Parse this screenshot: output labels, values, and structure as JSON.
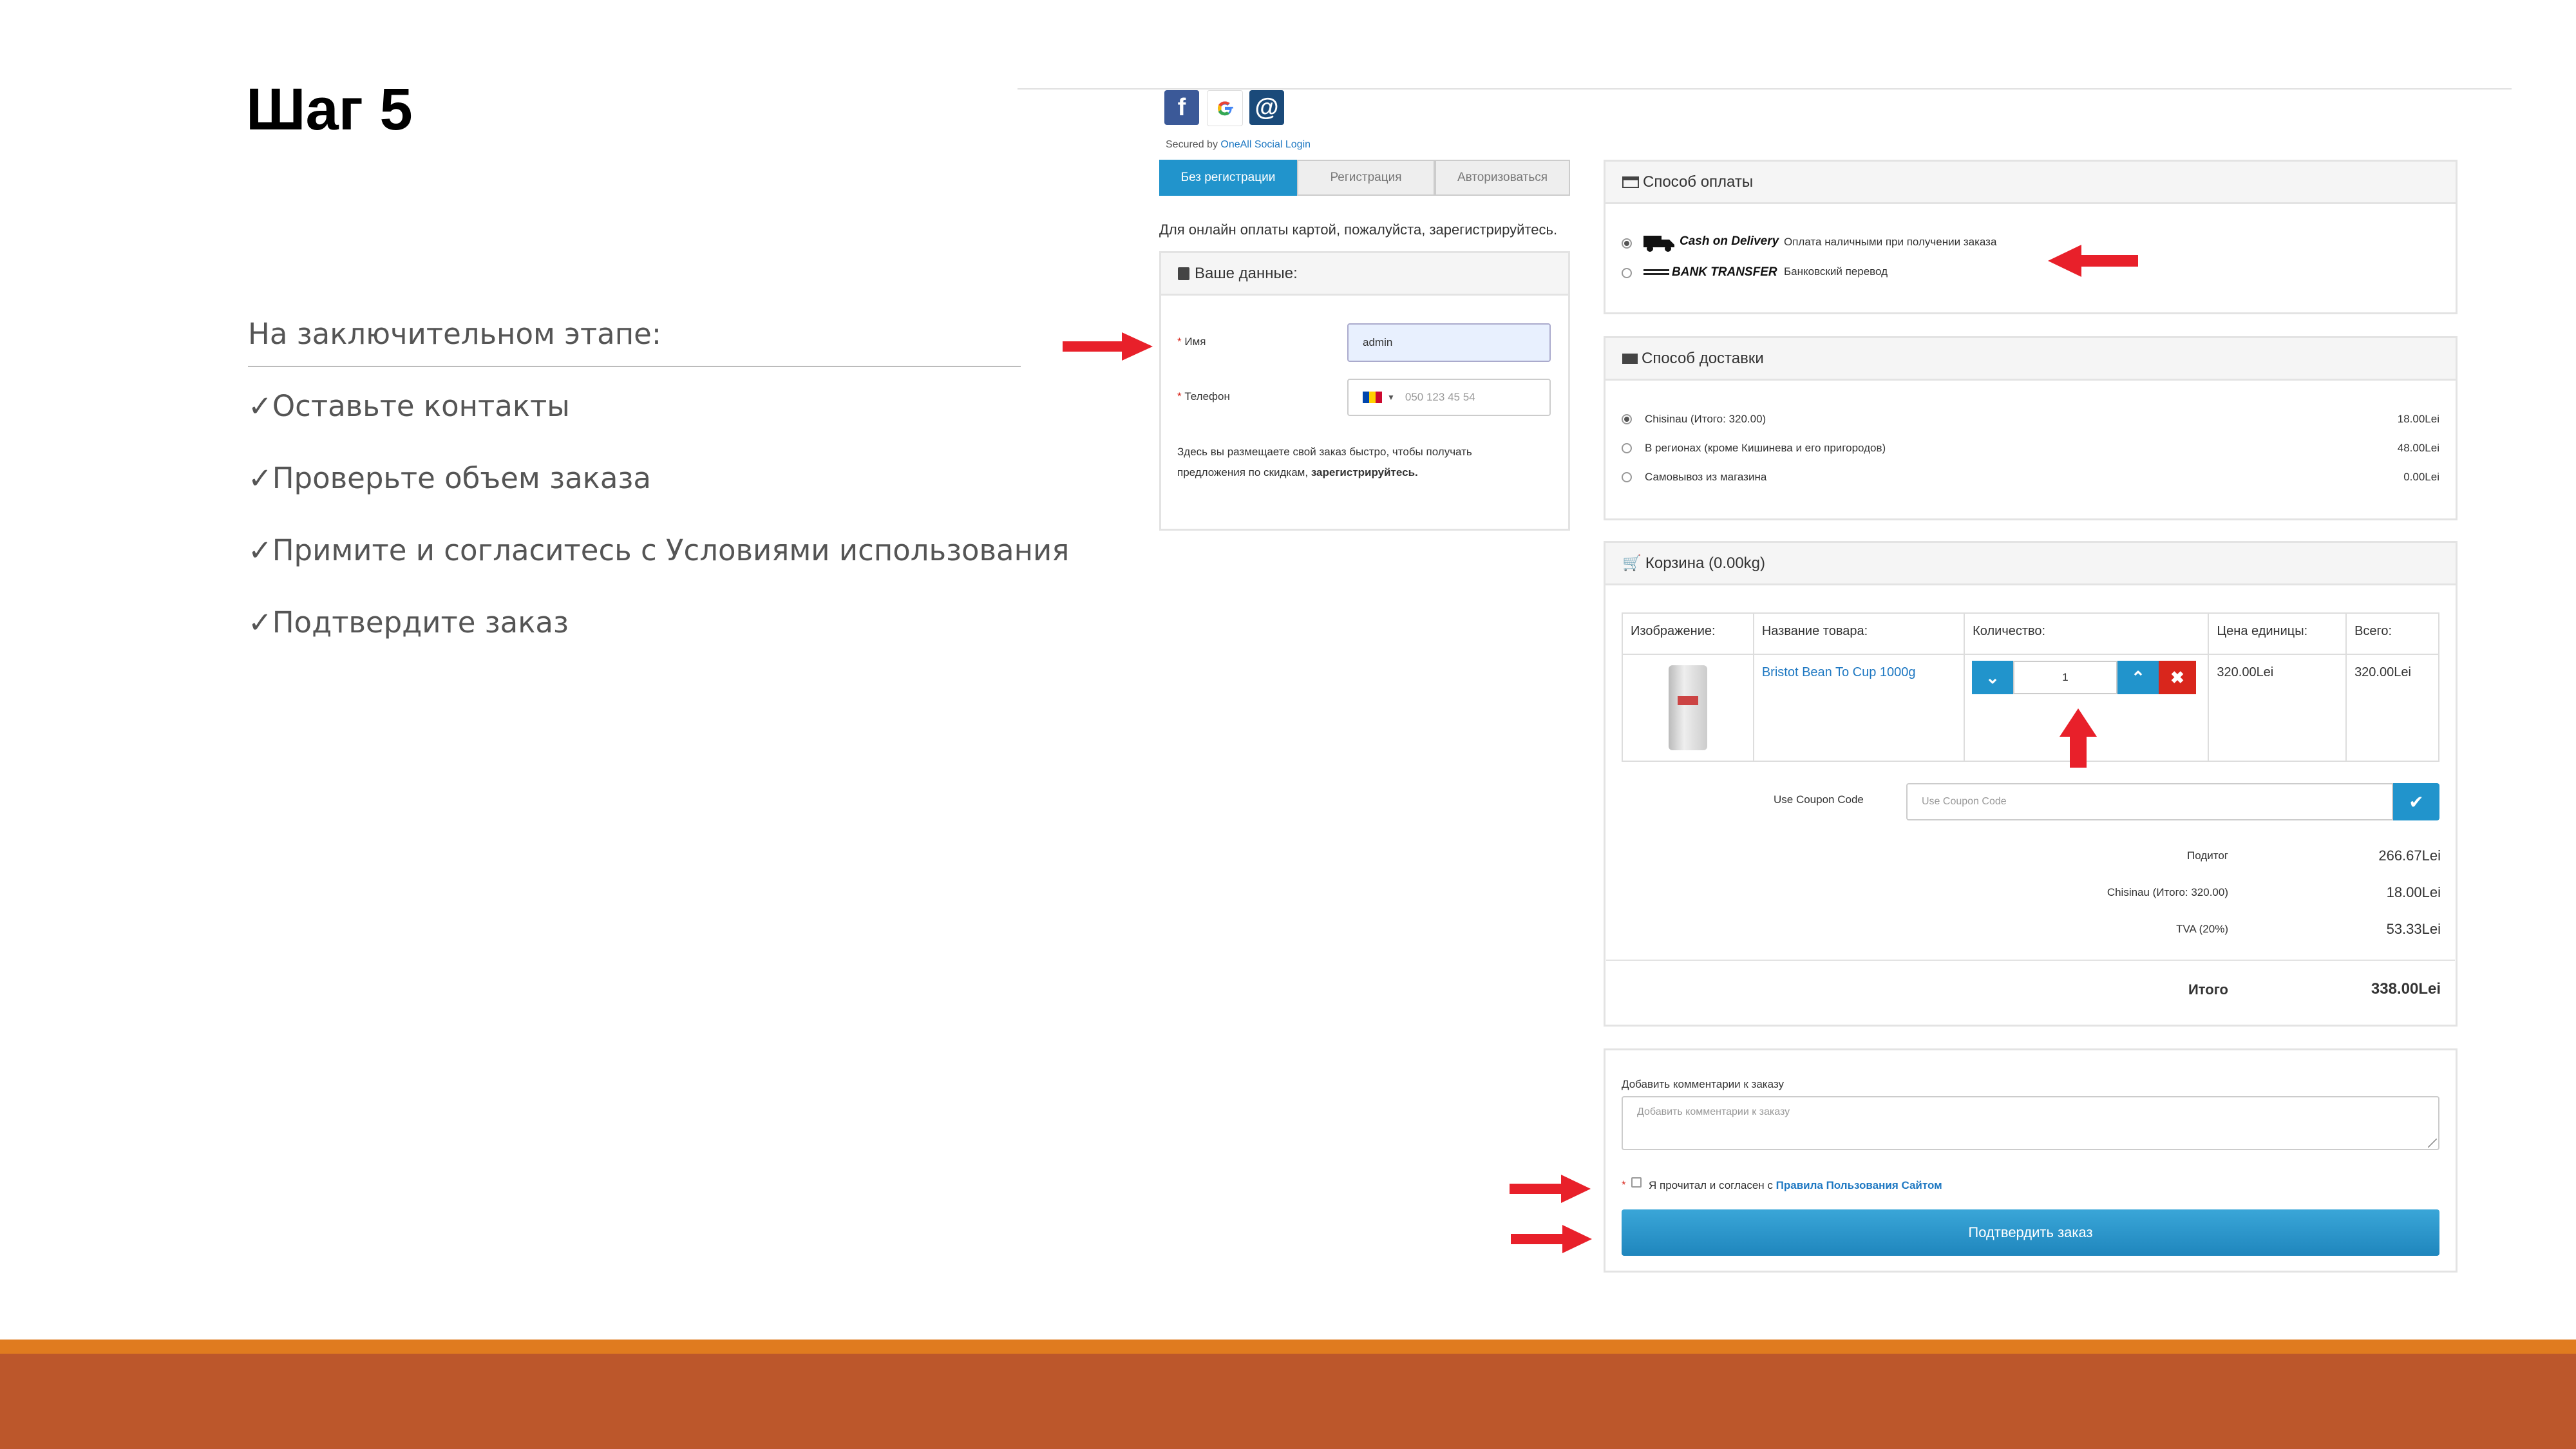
{
  "slide": {
    "title": "Шаг 5",
    "intro": "На заключительном этапе:",
    "bullets": [
      "✓Оставьте контакты",
      "✓Проверьте объем заказа",
      "✓Примите и согласитесь с Условиями использования",
      "✓Подтвердите заказ"
    ]
  },
  "social": {
    "icons": [
      "facebook-icon",
      "google-icon",
      "at-sign-icon"
    ],
    "secured_prefix": "Secured by ",
    "secured_link": "OneAll Social Login"
  },
  "tabs": [
    "Без регистрации",
    "Регистрация",
    "Авторизоваться"
  ],
  "online_note": "Для онлайн оплаты картой, пожалуйста, зарегистрируйтесь.",
  "your_data": {
    "title": "Ваше данные:",
    "name_label": "Имя",
    "name_value": "admin",
    "phone_label": "Телефон",
    "phone_placeholder": "050 123 45 54",
    "info_text": "Здесь вы размещаете свой заказ быстро, чтобы получать предложения по скидкам,",
    "info_link": "зарегистрируйтесь."
  },
  "payment": {
    "title": "Способ оплаты",
    "options": [
      {
        "brand": "Cash on Delivery",
        "desc": "Оплата наличными при получении заказа",
        "selected": true
      },
      {
        "brand": "BANK TRANSFER",
        "desc": "Банковский перевод",
        "selected": false
      }
    ]
  },
  "delivery": {
    "title": "Способ доставки",
    "options": [
      {
        "label": "Chisinau (Итого: 320.00)",
        "price": "18.00Lei",
        "selected": true
      },
      {
        "label": "В регионах (кроме Кишинева и его пригородов)",
        "price": "48.00Lei",
        "selected": false
      },
      {
        "label": "Самовывоз из магазина",
        "price": "0.00Lei",
        "selected": false
      }
    ]
  },
  "cart": {
    "title": "Корзина (0.00kg)",
    "headers": [
      "Изображение:",
      "Название товара:",
      "Количество:",
      "Цена единицы:",
      "Всего:"
    ],
    "item": {
      "name": "Bristot Bean To Cup 1000g",
      "qty": "1",
      "unit_price": "320.00Lei",
      "total": "320.00Lei"
    },
    "coupon_label": "Use Coupon Code",
    "coupon_placeholder": "Use Coupon Code",
    "totals": [
      {
        "label": "Подитог",
        "value": "266.67Lei"
      },
      {
        "label": "Chisinau (Итого: 320.00)",
        "value": "18.00Lei"
      },
      {
        "label": "TVA (20%)",
        "value": "53.33Lei"
      }
    ],
    "grand_label": "Итого",
    "grand_value": "338.00Lei"
  },
  "comment": {
    "label": "Добавить комментарии к заказу",
    "placeholder": "Добавить комментарии к заказу",
    "terms_prefix": "Я прочитал и согласен с ",
    "terms_link": "Правила Пользования Сайтом",
    "confirm": "Подтвердить заказ"
  },
  "colors": {
    "accent": "#2194cc",
    "danger": "#d9261c",
    "arrow": "#e8202a",
    "footer_orange": "#e07b1f",
    "footer_rust": "#bc572b"
  }
}
